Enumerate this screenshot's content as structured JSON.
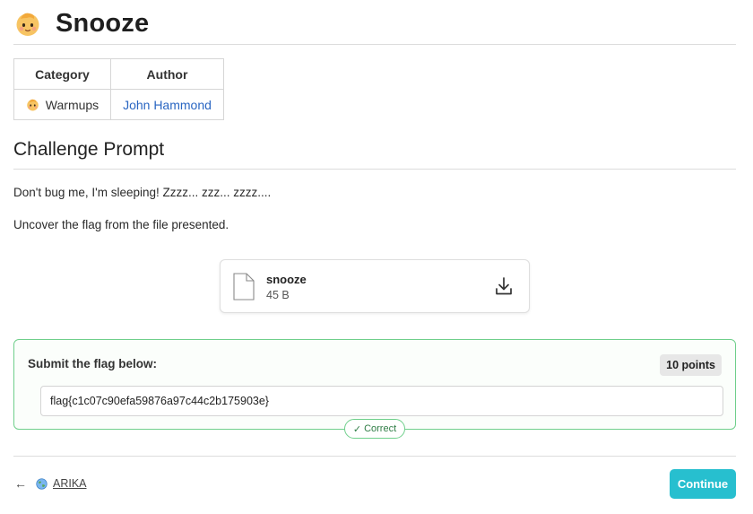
{
  "page": {
    "title": "Snooze"
  },
  "meta_table": {
    "headers": {
      "category": "Category",
      "author": "Author"
    },
    "category": "Warmups",
    "author": "John Hammond"
  },
  "challenge": {
    "heading": "Challenge Prompt",
    "line1": "Don't bug me, I'm sleeping! Zzzz... zzz... zzzz....",
    "line2": "Uncover the flag from the file presented."
  },
  "file": {
    "name": "snooze",
    "size": "45 B"
  },
  "flag_submission": {
    "label": "Submit the flag below:",
    "points": "10 points",
    "value": "flag{c1c07c90efa59876a97c44c2b175903e}",
    "status": "Correct",
    "status_icon": "✓"
  },
  "footer": {
    "back_arrow": "←",
    "link_text": "ARIKA",
    "continue_label": "Continue"
  },
  "icons": {
    "title_icon": "baby-face-icon",
    "category_icon": "baby-face-icon",
    "file_icon": "file-icon",
    "download_icon": "download-icon",
    "footer_icon": "globe-icon"
  },
  "colors": {
    "accent": "#27bfcf",
    "success_border": "#6fcf8b",
    "link": "#2a66c2"
  }
}
